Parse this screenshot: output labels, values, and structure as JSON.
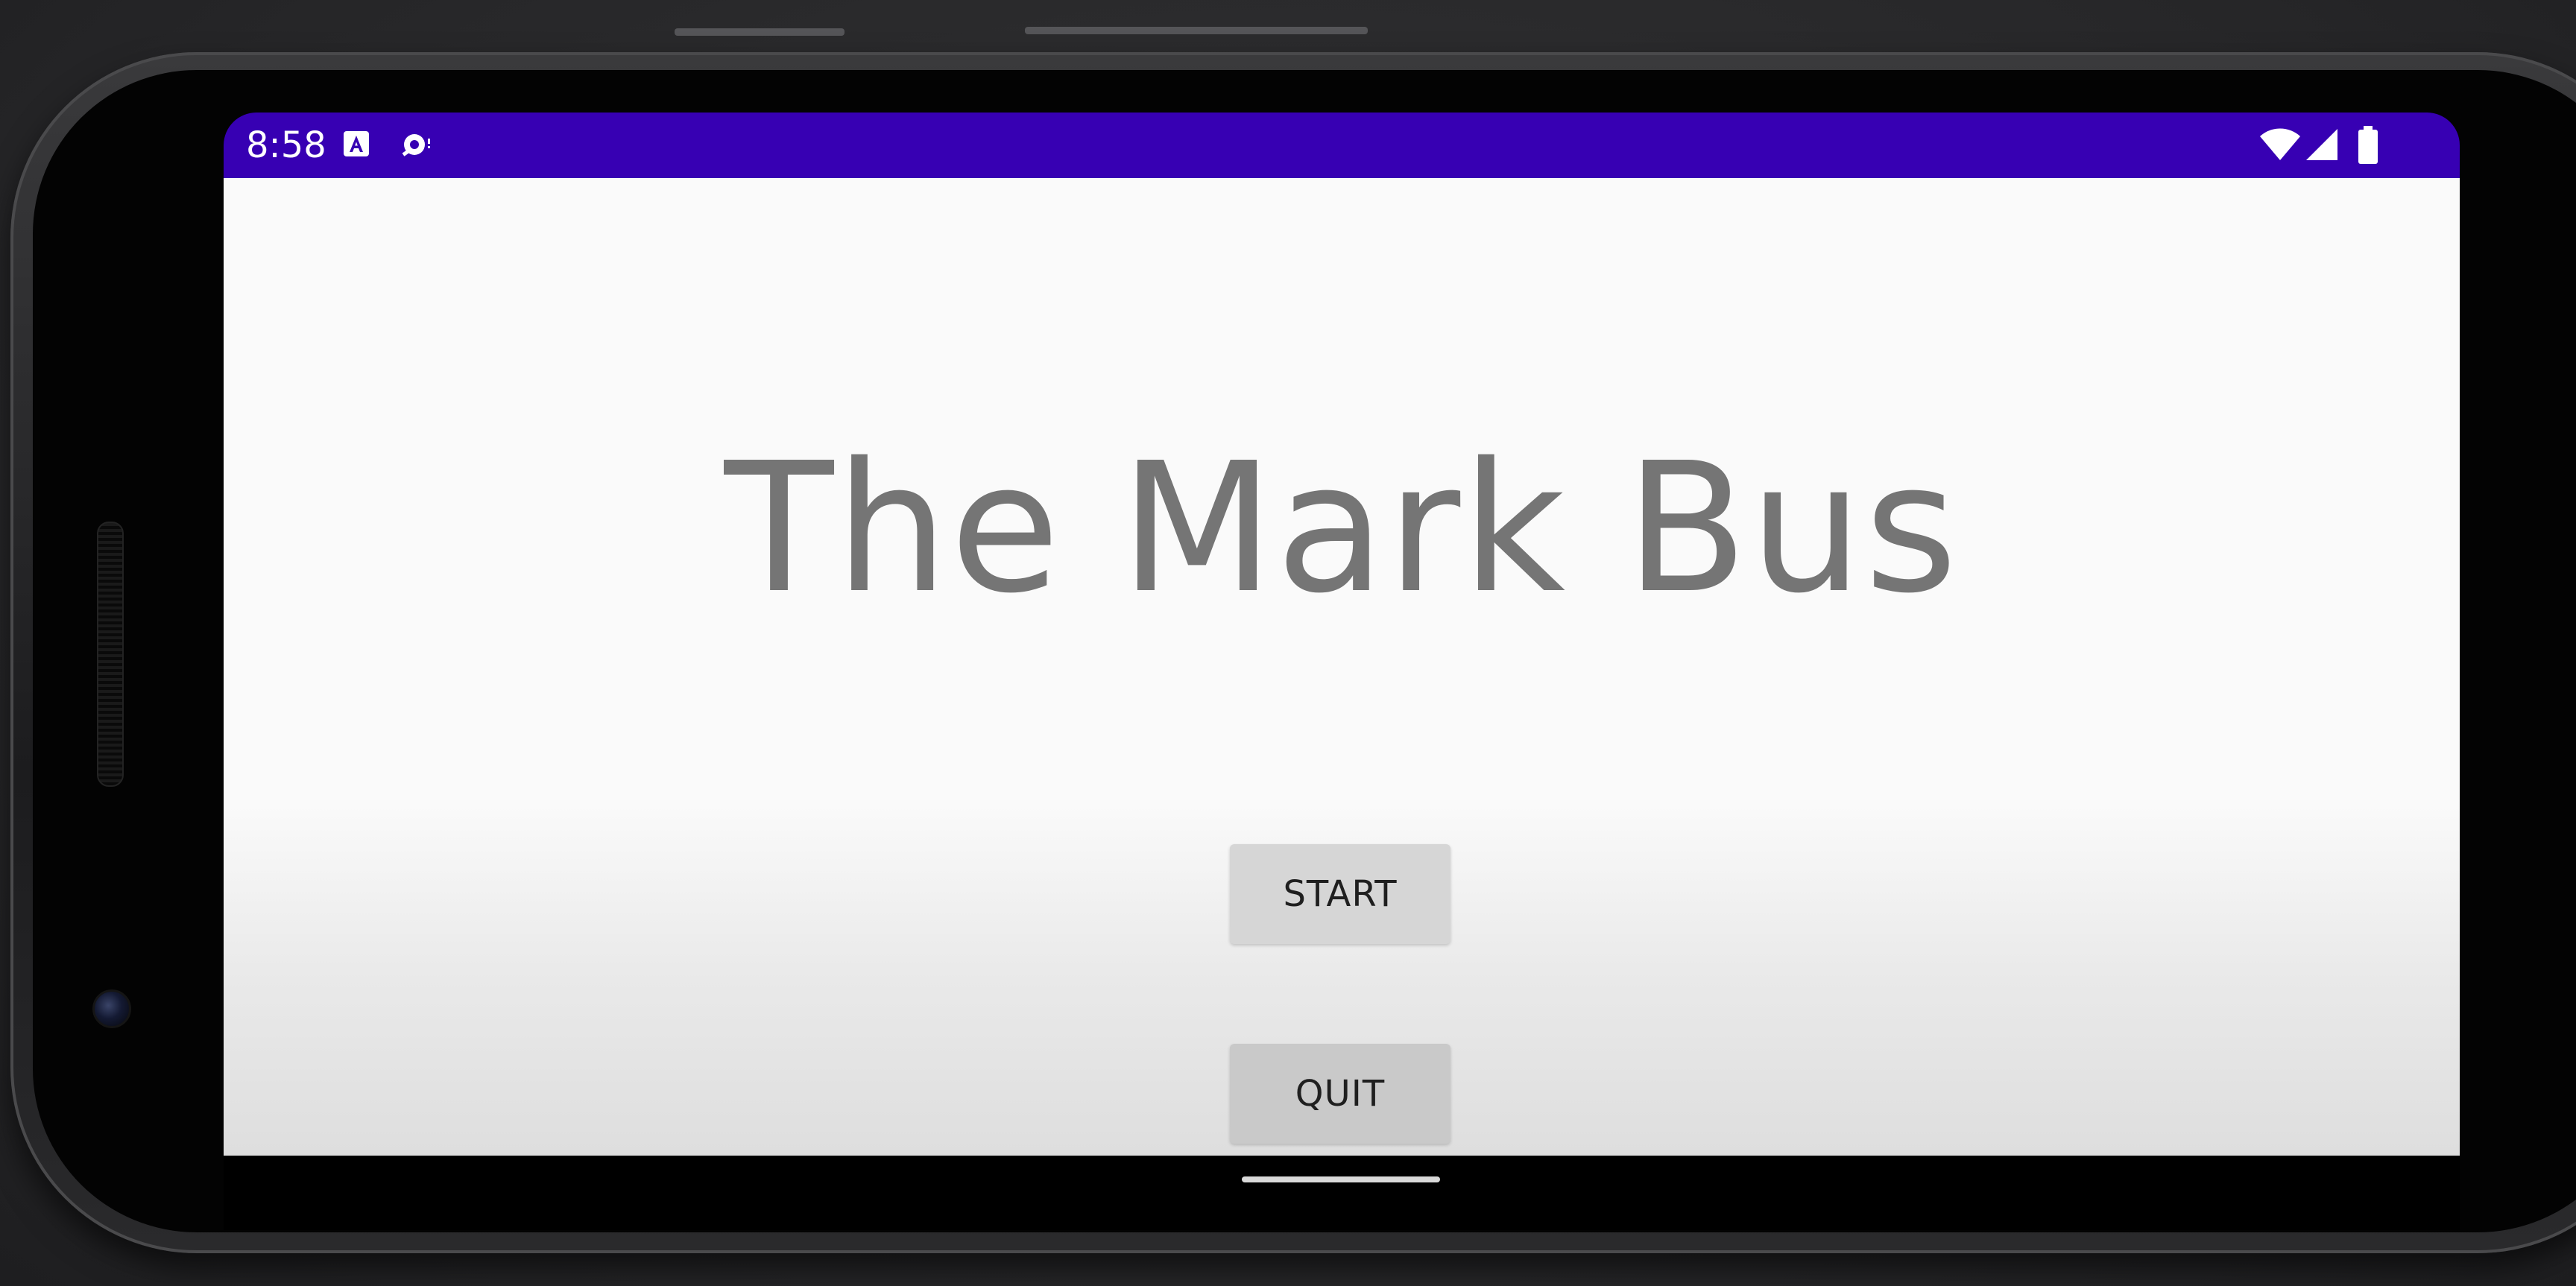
{
  "status_bar": {
    "time": "8:58",
    "background_color": "#3700b3",
    "left_icons": [
      "accessibility-notification-icon",
      "bug-notification-icon"
    ],
    "right_icons": [
      "wifi-icon",
      "cell-signal-icon",
      "battery-icon"
    ]
  },
  "app": {
    "title": "The Mark Bus",
    "title_color": "#757575",
    "buttons": {
      "start_label": "START",
      "quit_label": "QUIT"
    }
  }
}
